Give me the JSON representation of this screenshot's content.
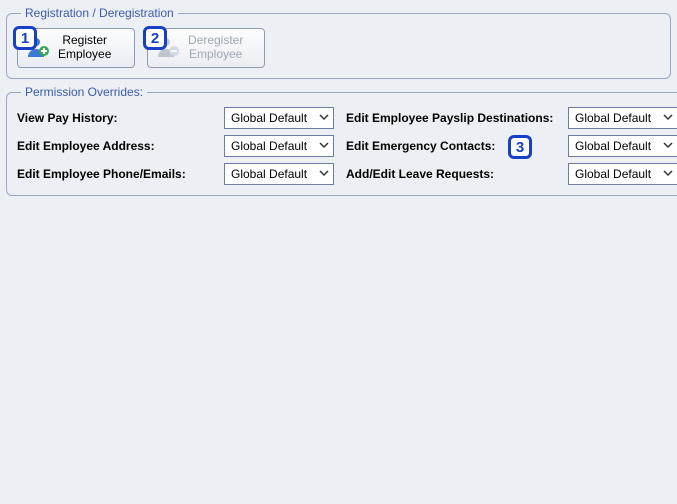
{
  "registration": {
    "legend": "Registration / Deregistration",
    "register_btn": "Register\nEmployee",
    "deregister_btn": "Deregister\nEmployee"
  },
  "permissions": {
    "legend": "Permission Overrides:",
    "default_value": "Global Default",
    "rows": [
      {
        "left_label": "View Pay History:",
        "right_label": "Edit Employee Payslip Destinations:"
      },
      {
        "left_label": "Edit Employee Address:",
        "right_label": "Edit Emergency Contacts:"
      },
      {
        "left_label": "Edit Employee Phone/Emails:",
        "right_label": "Add/Edit Leave Requests:"
      }
    ]
  },
  "markers": {
    "m1": "1",
    "m2": "2",
    "m3": "3"
  },
  "colors": {
    "accent": "#1740c6",
    "legend": "#3b5bb3",
    "bg": "#eceff4",
    "border": "#9aa8c0"
  }
}
